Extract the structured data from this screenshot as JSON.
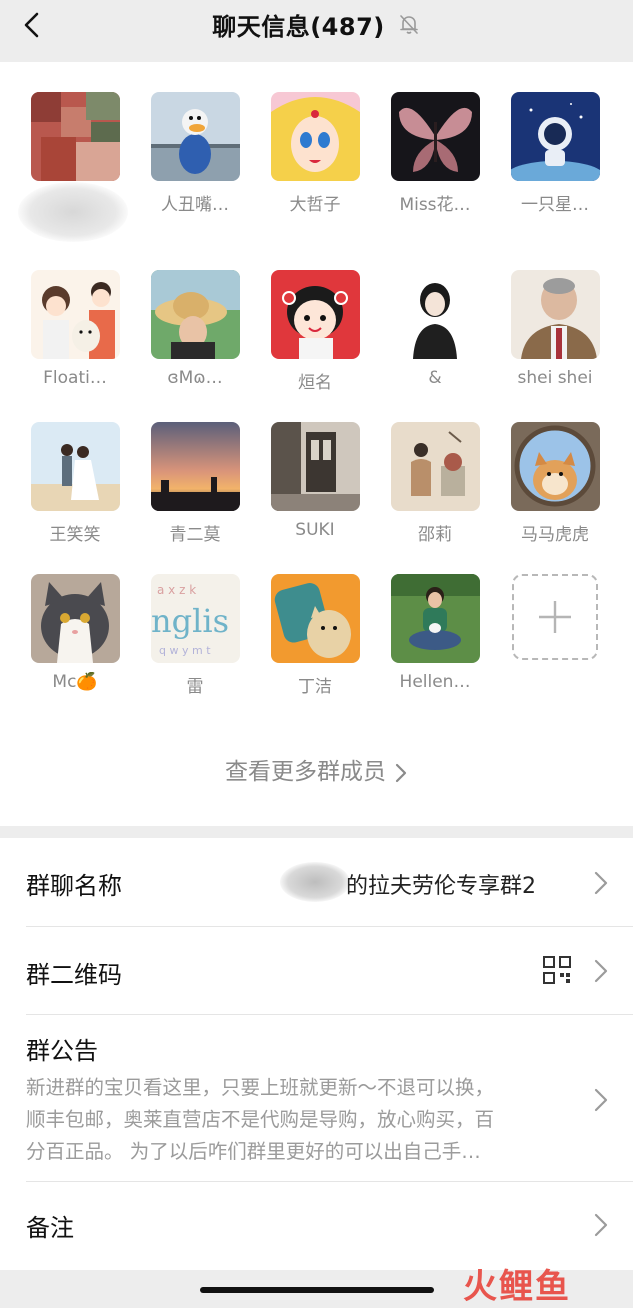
{
  "header": {
    "title": "聊天信息(487)"
  },
  "members": [
    {
      "name": ""
    },
    {
      "name": "人丑嘴…"
    },
    {
      "name": "大哲子"
    },
    {
      "name": "Miss花…"
    },
    {
      "name": "一只星…"
    },
    {
      "name": "Floati…"
    },
    {
      "name": "ɞMɷ…"
    },
    {
      "name": "烜名"
    },
    {
      "name": "&"
    },
    {
      "name": "shei shei"
    },
    {
      "name": "王笑笑"
    },
    {
      "name": "青二莫"
    },
    {
      "name": "SUKI"
    },
    {
      "name": "邵莉"
    },
    {
      "name": "马马虎虎"
    },
    {
      "name": "Mc🍊"
    },
    {
      "name": "雷"
    },
    {
      "name": "丁洁"
    },
    {
      "name": "Hellen…"
    }
  ],
  "more_members": "查看更多群成员",
  "settings": {
    "group_name_label": "群聊名称",
    "group_name_value": "的拉夫劳伦专享群2",
    "qr_label": "群二维码",
    "notice_label": "群公告",
    "notice_lines": [
      "新进群的宝贝看这里，只要上班就更新～不退可以换，",
      "顺丰包邮，奥莱直营店不是代购是导购，放心购买，百",
      "分百正品。 为了以后咋们群里更好的可以出自己手…"
    ],
    "remark_label": "备注"
  },
  "watermark": "火鲤鱼",
  "colors": {
    "background": "#ededed",
    "panel": "#ffffff",
    "muted_text": "#8a8a8a",
    "watermark": "#e8453c"
  }
}
